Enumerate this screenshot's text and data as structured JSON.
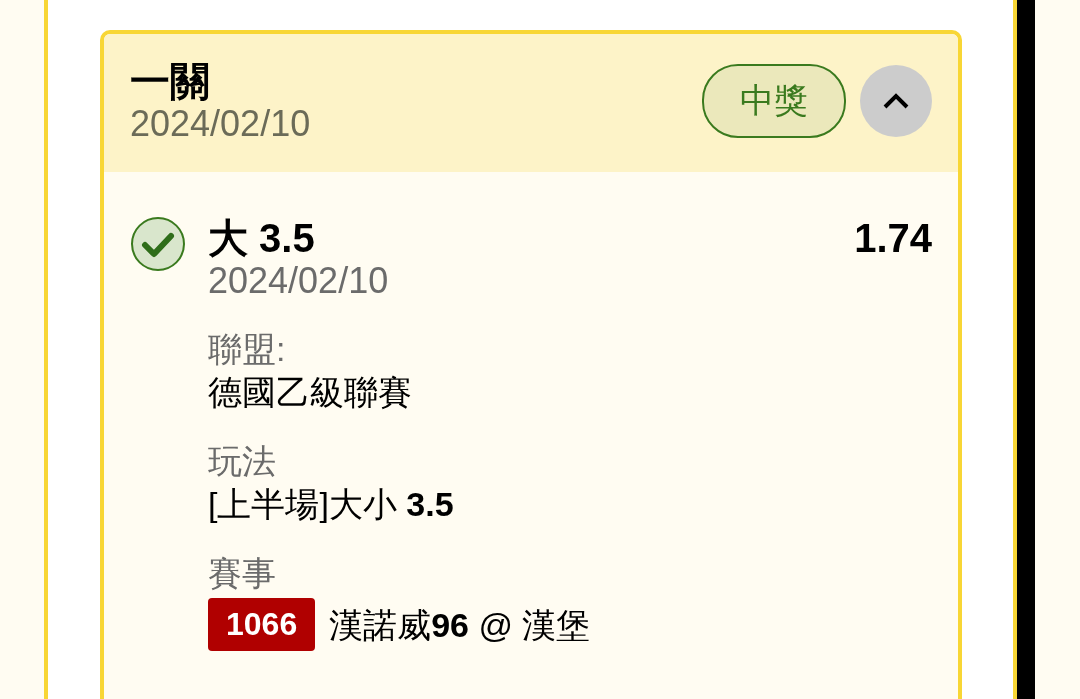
{
  "bet": {
    "title": "一關",
    "date": "2024/02/10",
    "result_badge": "中獎",
    "expanded": true,
    "legs": [
      {
        "selection": "大 3.5",
        "date": "2024/02/10",
        "odds": "1.74",
        "checked": true,
        "fields": [
          {
            "label": "聯盟:",
            "value": "德國乙級聯賽"
          },
          {
            "label": "玩法",
            "value": "[上半場]大小 **3.5**"
          },
          {
            "label": "賽事",
            "match_number": "1066",
            "value": "漢諾威**96** @ 漢堡"
          }
        ]
      }
    ]
  }
}
